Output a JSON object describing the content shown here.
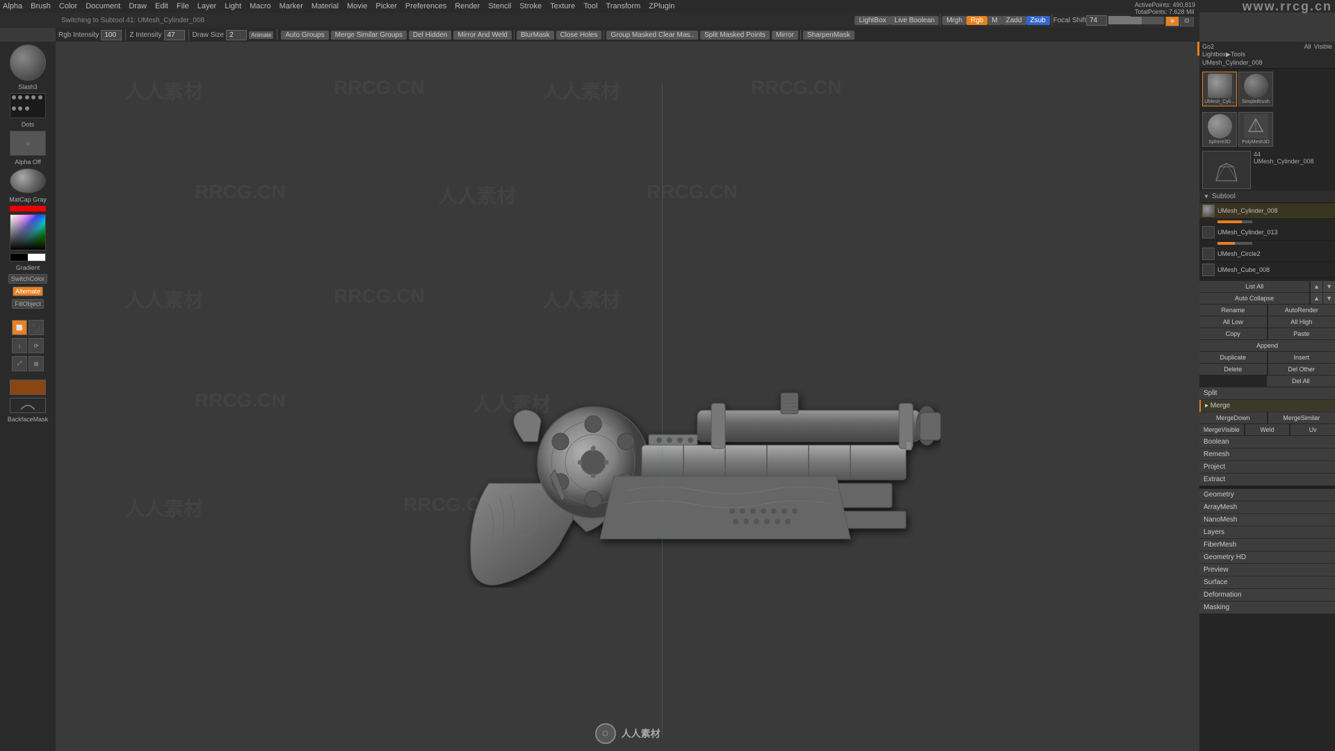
{
  "topbar": {
    "switching_text": "Switching to Subtool 41: UMesh_Cylinder_008",
    "menu_items": [
      "Alpha",
      "Brush",
      "Color",
      "Document",
      "Draw",
      "Edit",
      "File",
      "Layer",
      "Light",
      "Macro",
      "Marker",
      "Material",
      "Movie",
      "Picker",
      "Preferences",
      "Render",
      "Stencil",
      "Stroke",
      "Texture",
      "Tool",
      "Transform",
      "ZPlugin"
    ]
  },
  "toolbar1": {
    "lightbox_label": "LightBox",
    "live_boolean_label": "Live Boolean",
    "mrgh_label": "Mrgh",
    "rgb_label": "Rgb",
    "m_label": "M",
    "zadd_label": "Zadd",
    "zsub_label": "Zsub",
    "rgb_intensity_label": "Rgb Intensity",
    "rgb_intensity_value": "100",
    "z_intensity_label": "Z Intensity",
    "z_intensity_value": "47",
    "draw_size_label": "Draw Size",
    "draw_size_value": "2",
    "focal_shift_label": "Focal Shift",
    "focal_shift_value": "74"
  },
  "toolbar2": {
    "auto_groups": "Auto Groups",
    "merge_similar_groups": "Merge Similar Groups",
    "del_hidden": "Del Hidden",
    "mirror_and_weld": "Mirror And Weld",
    "blur_mask": "BlurMask",
    "close_holes": "Close Holes",
    "group_masked_clear_mask": "Group Masked Clear Mas..",
    "split_masked_points": "Split Masked Points",
    "mirror": "Mirror",
    "sharpen_mask": "SharpenMask"
  },
  "right_panel": {
    "go2_label": "Go2",
    "all_label": "All",
    "visible_label": "Visible",
    "active_points": "ActivePoints: 490,819",
    "total_points": "TotalPoints: 7.628 Mil",
    "lightbox_path": "Lightbox▶Tools",
    "active_mesh": "UMesh_Cylinder_008",
    "subtool_label": "Subtool",
    "mesh_count": "44",
    "subtools": [
      {
        "name": "UMesh_Cylinder_008",
        "active": true
      },
      {
        "name": "UMesh_Cylinder_013",
        "active": false
      },
      {
        "name": "UMesh_Circle2",
        "active": false
      },
      {
        "name": "UMesh_Cube_008",
        "active": false
      }
    ],
    "list_all": "List All",
    "auto_collapse": "Auto Collapse",
    "rename": "Rename",
    "auto_render": "AutoRender",
    "all_low": "All Low",
    "all_high": "All High",
    "copy": "Copy",
    "append": "Append",
    "duplicate": "Duplicate",
    "insert": "Insert",
    "delete": "Delete",
    "del_other": "Del Other",
    "del_all": "Del All",
    "split": "Split",
    "merge": "▸ Merge",
    "merge_down": "MergeDown",
    "merge_similar": "MergeSimilar",
    "merge_visible": "MergeVisible",
    "weld": "Weld",
    "uv": "Uv",
    "boolean": "Boolean",
    "remesh": "Remesh",
    "project": "Project",
    "extract": "Extract",
    "geometry": "Geometry",
    "array_mesh": "ArrayMesh",
    "nano_mesh": "NanoMesh",
    "layers": "Layers",
    "fiber_mesh": "FiberMesh",
    "geometry_hd": "Geometry HD",
    "preview": "Preview",
    "surface": "Surface",
    "deformation": "Deformation",
    "masking": "Masking"
  },
  "left_panel": {
    "brush_name": "Slash3",
    "dots_label": "Dots",
    "alpha_label": "Alpha Off",
    "matcap_label": "MatCap Gray",
    "gradient_label": "Gradient",
    "switch_color": "SwitchColor",
    "alternate": "Alternate",
    "fill_object": "FillObject",
    "backface_mask": "BackfaceMask"
  },
  "canvas": {
    "bottom_text": "",
    "watermarks": [
      "RRCG.CN",
      "人人素材",
      "RRCG.CN"
    ]
  },
  "masked_clear_text": "Masked Clear"
}
